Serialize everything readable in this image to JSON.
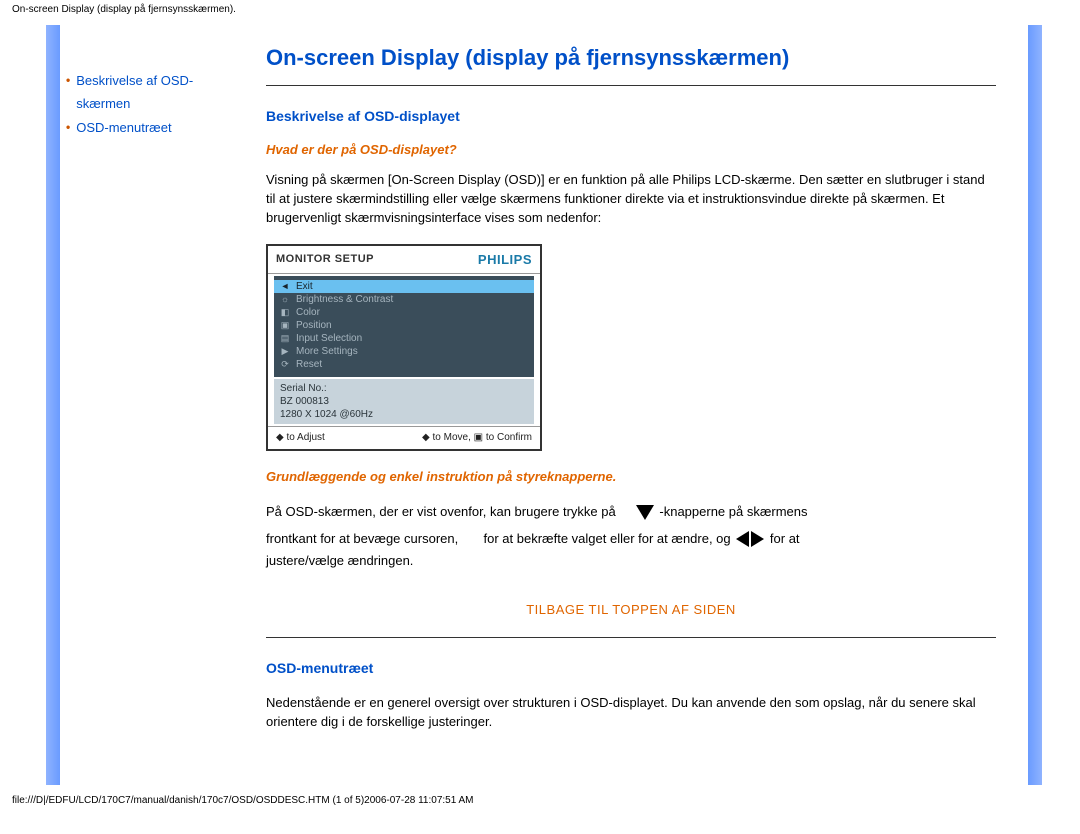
{
  "header_text": "On-screen Display (display på fjernsynsskærmen).",
  "nav": {
    "items": [
      {
        "label": "Beskrivelse af OSD-skærmen"
      },
      {
        "label": "OSD-menutræet"
      }
    ]
  },
  "main": {
    "title": "On-screen Display (display på fjernsynsskærmen)",
    "section1": {
      "heading": "Beskrivelse af OSD-displayet",
      "q": "Hvad er der på OSD-displayet?",
      "para": "Visning på skærmen [On-Screen Display (OSD)] er en funktion på alle Philips LCD-skærme. Den sætter en slutbruger i stand til at justere skærmindstilling eller vælge skærmens funktioner direkte via et instruktionsvindue direkte på skærmen. Et brugervenligt skærmvisningsinterface vises som nedenfor:"
    },
    "osd": {
      "title": "MONITOR SETUP",
      "brand": "PHILIPS",
      "items": [
        {
          "glyph": "◄",
          "label": "Exit",
          "selected": true
        },
        {
          "glyph": "☼",
          "label": "Brightness & Contrast",
          "selected": false
        },
        {
          "glyph": "◧",
          "label": "Color",
          "selected": false
        },
        {
          "glyph": "▣",
          "label": "Position",
          "selected": false
        },
        {
          "glyph": "▤",
          "label": "Input Selection",
          "selected": false
        },
        {
          "glyph": "▶",
          "label": "More Settings",
          "selected": false
        },
        {
          "glyph": "⟳",
          "label": "Reset",
          "selected": false
        }
      ],
      "info_line1": "Serial No.:",
      "info_line2": "BZ 000813",
      "info_line3": "1280 X 1024 @60Hz",
      "footer_left": "◆ to Adjust",
      "footer_right": "◆ to Move, ▣ to Confirm"
    },
    "instr_heading": "Grundlæggende og enkel instruktion på styreknapperne.",
    "instr": {
      "p1a": "På OSD-skærmen, der er vist ovenfor, kan brugere trykke på",
      "p1b": "-knapperne på skærmens",
      "p2a": "frontkant for at bevæge cursoren,",
      "p2b": "for at bekræfte valget eller for at ændre, og",
      "p2c": "for at",
      "p3": "justere/vælge ændringen."
    },
    "toplink": "TILBAGE TIL TOPPEN AF SIDEN",
    "section2": {
      "heading": "OSD-menutræet",
      "para": "Nedenstående er en generel oversigt over strukturen i OSD-displayet. Du kan anvende den som opslag, når du senere skal orientere dig i de forskellige justeringer."
    }
  },
  "footer_path": "file:///D|/EDFU/LCD/170C7/manual/danish/170c7/OSD/OSDDESC.HTM (1 of 5)2006-07-28 11:07:51 AM"
}
